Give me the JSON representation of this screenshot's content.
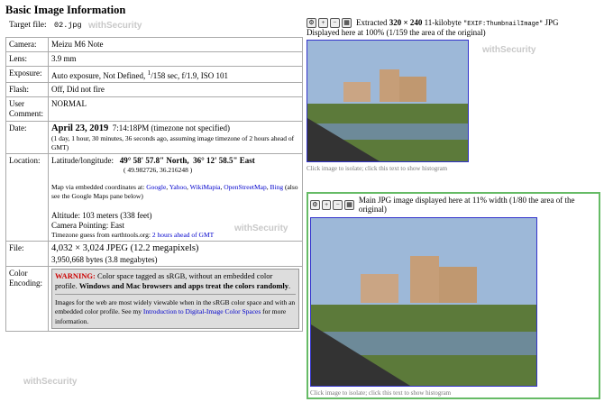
{
  "heading": "Basic Image Information",
  "target_label": "Target file:",
  "target_value": "02.jpg",
  "rows": {
    "camera": {
      "label": "Camera:",
      "value": "Meizu M6 Note"
    },
    "lens": {
      "label": "Lens:",
      "value": "3.9 mm"
    },
    "exposure": {
      "label": "Exposure:",
      "value_prefix": "Auto exposure, Not Defined, ",
      "num": "1",
      "value_suffix": "/158 sec, f/1.9, ISO 101"
    },
    "flash": {
      "label": "Flash:",
      "value": "Off, Did not fire"
    },
    "comment": {
      "label": "User Comment:",
      "value": "NORMAL"
    },
    "date": {
      "label": "Date:",
      "date": "April 23, 2019",
      "time": "7:14:18PM (timezone not specified)",
      "ago": "(1 day, 1 hour, 30 minutes, 36 seconds ago, assuming image timezone of 2 hours ahead of GMT)"
    },
    "location": {
      "label": "Location:",
      "latlon_label": "Latitude/longitude:",
      "lat": "49° 58' 57.8\" North,",
      "lon": "36° 12' 58.5\" East",
      "decimal": "( 49.982726, 36.216248 )",
      "map_text": "Map via embedded coordinates at:",
      "map_links": [
        "Google",
        "Yahoo",
        "WikiMapia",
        "OpenStreetMap",
        "Bing"
      ],
      "map_note": "(also see the Google Maps pane below)",
      "altitude": "Altitude: 103 meters (338 feet)",
      "pointing": "Camera Pointing: East",
      "tz_text": "Timezone guess from earthtools.org:",
      "tz_link": "2 hours ahead of GMT"
    },
    "file": {
      "label": "File:",
      "line1": "4,032 × 3,024 JPEG (12.2 megapixels)",
      "line2": "3,950,668 bytes (3.8 megabytes)"
    },
    "color": {
      "label": "Color Encoding:",
      "warn_word": "WARNING:",
      "warn_text": "Color space tagged as sRGB, without an embedded color profile.",
      "warn_bold": "Windows and Mac browsers and apps treat the colors randomly",
      "note": "Images for the web are most widely viewable when in the sRGB color space and with an embedded color profile. See my",
      "note_link": "Introduction to Digital-Image Color Spaces",
      "note_end": "for more information."
    }
  },
  "thumb": {
    "text_a": "Extracted",
    "dims": "320 × 240",
    "text_b": "11-kilobyte",
    "tag": "\"EXIF:ThumbnailImage\"",
    "text_c": "JPG",
    "line2": "Displayed here at 100% (1/159 the area of the original)",
    "caption": "Click image to isolate; click this text to show histogram"
  },
  "main": {
    "line": "Main JPG image displayed here at 11% width (1/80 the area of the original)",
    "caption": "Click image to isolate; click this text to show histogram"
  },
  "watermark": "withSecurity",
  "colors": {
    "frame": "#3333cc",
    "panel_border": "#66bb66",
    "link": "#0000cc",
    "warning": "#cc0000"
  }
}
